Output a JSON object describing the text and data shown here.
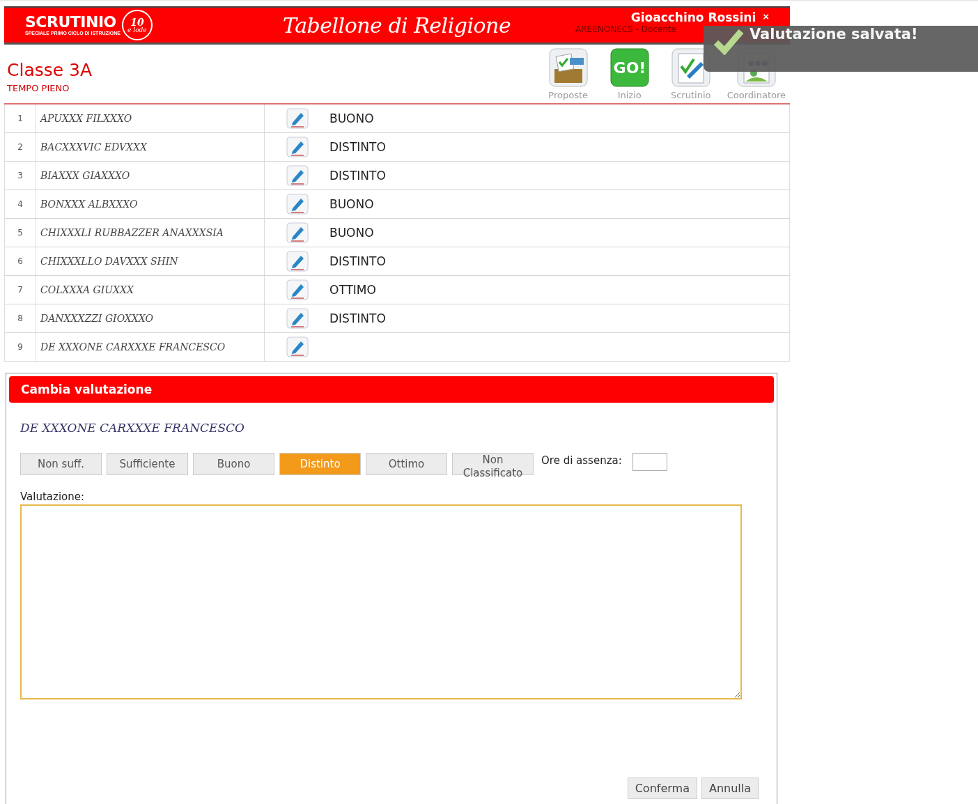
{
  "header": {
    "logo": {
      "name": "SCRUTINIO",
      "tagline": "SPECIALE PRIMO CICLO DI ISTRUZIONE",
      "badge_number": "10",
      "badge_word": "e lode"
    },
    "title": "Tabellone di Religione",
    "user": {
      "name": "Gioacchino Rossini",
      "close": "×",
      "role": "AREENONECS - Docente"
    }
  },
  "toast": {
    "message": "Valutazione salvata!"
  },
  "class_info": {
    "name": "Classe 3A",
    "schedule": "TEMPO PIENO"
  },
  "toolbar": [
    {
      "kind": "ballot",
      "label": "Proposte"
    },
    {
      "kind": "go",
      "label": "Inizio",
      "icon_text": "GO!"
    },
    {
      "kind": "check",
      "label": "Scrutinio"
    },
    {
      "kind": "group",
      "label": "Coordinatore"
    }
  ],
  "students": [
    {
      "number": "1",
      "name": "APUXXX FILXXXO",
      "grade": "BUONO"
    },
    {
      "number": "2",
      "name": "BACXXXVIC EDVXXX",
      "grade": "DISTINTO"
    },
    {
      "number": "3",
      "name": "BIAXXX GIAXXXO",
      "grade": "DISTINTO"
    },
    {
      "number": "4",
      "name": "BONXXX ALBXXXO",
      "grade": "BUONO"
    },
    {
      "number": "5",
      "name": "CHIXXXLI RUBBAZZER ANAXXXSIA",
      "grade": "BUONO"
    },
    {
      "number": "6",
      "name": "CHIXXXLLO DAVXXX SHIN",
      "grade": "DISTINTO"
    },
    {
      "number": "7",
      "name": "COLXXXA GIUXXX",
      "grade": "OTTIMO"
    },
    {
      "number": "8",
      "name": "DANXXXZZI GIOXXXO",
      "grade": "DISTINTO"
    },
    {
      "number": "9",
      "name": "DE XXXONE CARXXXE FRANCESCO"
    }
  ],
  "dialog": {
    "title": "Cambia valutazione",
    "student": "DE XXXONE CARXXXE FRANCESCO",
    "grades": [
      {
        "label": "Non suff.",
        "selected": false
      },
      {
        "label": "Sufficiente",
        "selected": false
      },
      {
        "label": "Buono",
        "selected": false
      },
      {
        "label": "Distinto",
        "selected": true
      },
      {
        "label": "Ottimo",
        "selected": false
      },
      {
        "label": "Non Classificato",
        "selected": false
      }
    ],
    "absence_label": "Ore di assenza:",
    "evaluation_label": "Valutazione:",
    "buttons": [
      "Conferma",
      "Annulla"
    ]
  }
}
